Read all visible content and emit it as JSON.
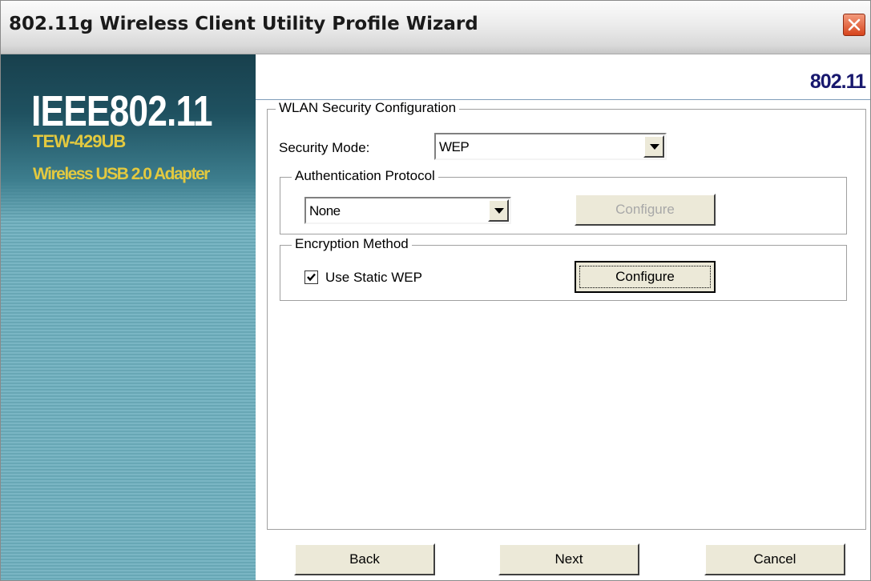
{
  "window": {
    "title": "802.11g Wireless Client Utility Profile Wizard"
  },
  "sidebar": {
    "brand_title": "IEEE802.11",
    "brand_model": "TEW-429UB",
    "brand_description": "Wireless USB 2.0 Adapter"
  },
  "header": {
    "corner_logo": "802.11"
  },
  "wlan_security": {
    "group_label": "WLAN Security Configuration",
    "security_mode_label": "Security Mode:",
    "security_mode_value": "WEP"
  },
  "authentication": {
    "group_label": "Authentication Protocol",
    "protocol_value": "None",
    "configure_label": "Configure",
    "configure_enabled": false
  },
  "encryption": {
    "group_label": "Encryption Method",
    "static_wep_label": "Use Static WEP",
    "static_wep_checked": true,
    "configure_label": "Configure"
  },
  "footer": {
    "back_label": "Back",
    "next_label": "Next",
    "cancel_label": "Cancel"
  },
  "colors": {
    "title_close": "#d6441c",
    "sidebar_teal": "#7ab6c4",
    "brand_yellow": "#e3c93f",
    "logo_navy": "#18186e"
  },
  "icons": {
    "close": "close-icon",
    "dropdown": "chevron-down-icon",
    "checkbox": "checkmark-icon"
  }
}
